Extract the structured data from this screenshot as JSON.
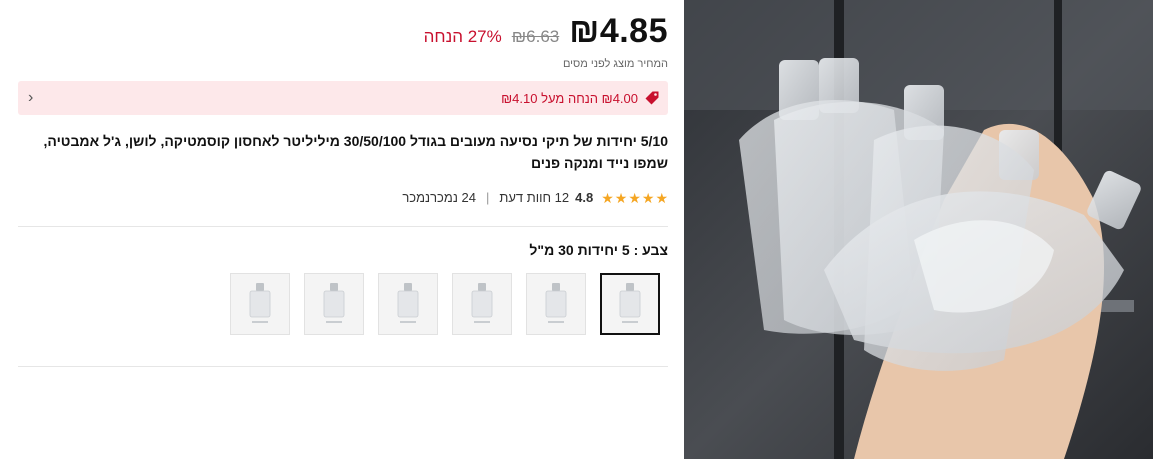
{
  "price": {
    "current": "₪4.85",
    "original": "₪6.63",
    "discount": "27% הנחה",
    "tax_note": "המחיר מוצג לפני מסים"
  },
  "coupon": {
    "text": "₪4.00 הנחה מעל ₪4.10",
    "icon": "tag-icon",
    "arrow_icon": "chevron-left-icon",
    "accent_color": "#c8102e",
    "background_color": "#fde8ea"
  },
  "product": {
    "title": "5/10 יחידות של תיקי נסיעה מעובים בגודל 30/50/100 מיליליטר לאחסון קוסמטיקה, לושן, ג'ל אמבטיה, שמפו נייד ומנקה פנים"
  },
  "rating": {
    "value": "4.8",
    "stars": 5,
    "reviews": "12 חוות דעת",
    "sold": "24 נמכרנמכר"
  },
  "variant": {
    "label": "צבע : 5 יחידות 30 מ\"ל",
    "selected_index": 0,
    "swatch_count": 6
  }
}
